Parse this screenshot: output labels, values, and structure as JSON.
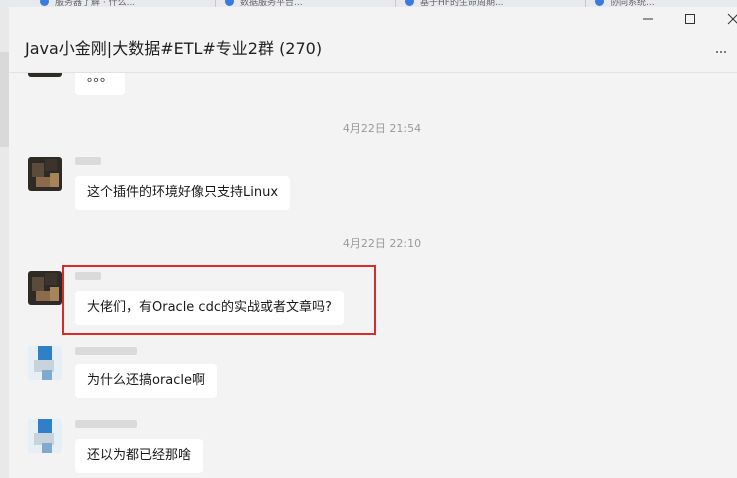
{
  "window": {
    "title": "Java小金刚|大数据#ETL#专业2群 (270)",
    "minimize_glyph": "—",
    "maximize_glyph": "☐",
    "close_glyph": "✕",
    "more_icon": "more-dots-icon"
  },
  "background_tabs": [
    {
      "label": "服务器了解 · 什么...",
      "color": "#3b7be0"
    },
    {
      "label": "数据服务平台...",
      "color": "#3b7be0"
    },
    {
      "label": "基于HF的生命周期...",
      "color": "#3b7be0"
    },
    {
      "label": "协同系统...",
      "color": "#3b7be0"
    }
  ],
  "messages": [
    {
      "type": "text",
      "text": "。。。"
    },
    {
      "type": "timestamp",
      "text": "4月22日 21:54"
    },
    {
      "type": "text",
      "text": "这个插件的环境好像只支持Linux",
      "avatar": "dark"
    },
    {
      "type": "timestamp",
      "text": "4月22日 22:10"
    },
    {
      "type": "text",
      "text": "大佬们，有Oracle cdc的实战或者文章吗?",
      "avatar": "dark",
      "highlighted": true
    },
    {
      "type": "text",
      "text": "为什么还搞oracle啊",
      "avatar": "light"
    },
    {
      "type": "text",
      "text": "还以为都已经那啥",
      "avatar": "light"
    }
  ],
  "colors": {
    "highlight": "#d92b2b",
    "bubble": "#ffffff",
    "chat_bg": "#f3f3f3"
  }
}
